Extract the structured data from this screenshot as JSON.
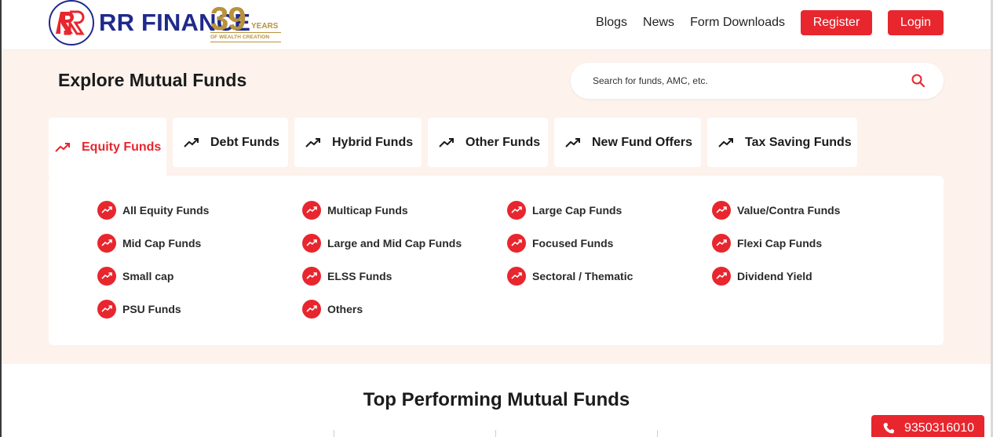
{
  "header": {
    "brand": "RR FINANCE",
    "logo_letters": "RR",
    "anniversary": {
      "number": "39",
      "word": "YEARS",
      "tagline": "OF WEALTH CREATION"
    },
    "nav": [
      "Blogs",
      "News",
      "Form Downloads"
    ],
    "register_label": "Register",
    "login_label": "Login"
  },
  "explore": {
    "title": "Explore Mutual Funds",
    "search_placeholder": "Search for funds, AMC, etc."
  },
  "tabs": [
    {
      "label": "Equity Funds",
      "active": true
    },
    {
      "label": "Debt Funds",
      "active": false
    },
    {
      "label": "Hybrid Funds",
      "active": false
    },
    {
      "label": "Other Funds",
      "active": false
    },
    {
      "label": "New Fund Offers",
      "active": false
    },
    {
      "label": "Tax Saving Funds",
      "active": false
    }
  ],
  "equity_categories": [
    [
      "All Equity Funds",
      "Mid Cap Funds",
      "Small cap",
      "PSU Funds"
    ],
    [
      "Multicap Funds",
      "Large and Mid Cap Funds",
      "ELSS Funds",
      "Others"
    ],
    [
      "Large Cap Funds",
      "Focused Funds",
      "Sectoral / Thematic"
    ],
    [
      "Value/Contra Funds",
      "Flexi Cap Funds",
      "Dividend Yield"
    ]
  ],
  "top_performing": {
    "title": "Top Performing Mutual Funds"
  },
  "contact": {
    "phone": "9350316010"
  },
  "colors": {
    "accent": "#e8262e",
    "brand": "#1f2a8c",
    "gold": "#b8923d",
    "section_bg": "#fdf2ec"
  },
  "icons": {
    "tab_icon": "trending-up-icon",
    "fund_icon": "trending-up-badge-icon",
    "search": "search-icon",
    "phone": "phone-icon"
  }
}
